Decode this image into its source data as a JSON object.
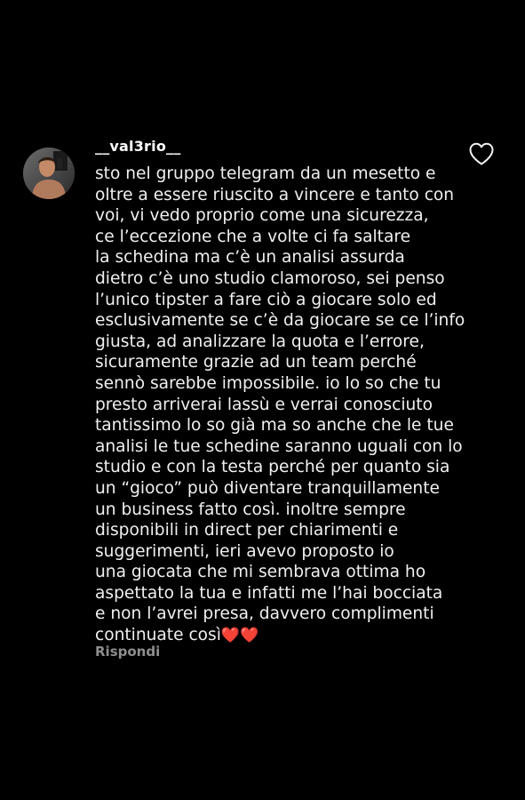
{
  "comment": {
    "username": "__val3rio__",
    "text": "sto nel gruppo telegram da un mesetto e\noltre a essere riuscito a vincere e tanto con\nvoi, vi vedo proprio come una sicurezza,\nce l’eccezione che a volte ci fa saltare\nla schedina ma c’è un analisi assurda\ndietro c’è uno studio clamoroso, sei penso\nl’unico tipster a fare ciò a giocare solo ed\nesclusivamente se c’è da giocare se ce l’info\ngiusta, ad analizzare la quota e l’errore,\nsicuramente grazie ad un team perché\nsennò sarebbe impossibile. io lo so che tu\npresto arriverai lassù e verrai conosciuto\ntantissimo lo so già ma so anche che le tue\nanalisi le tue schedine saranno uguali con lo\nstudio e con la testa perché per quanto sia\nun “gioco” può diventare tranquillamente\nun business fatto così. inoltre sempre\ndisponibili in direct per chiarimenti e\nsuggerimenti, ieri avevo proposto io\nuna giocata che mi sembrava ottima ho\naspettato la tua e infatti me l’hai bocciata\ne non l’avrei presa, davvero complimenti\ncontinuate così",
    "emoji": "❤️❤️",
    "reply_label": "Rispondi",
    "like_icon": "heart-outline-icon"
  },
  "colors": {
    "background": "#000000",
    "text": "#f0f0f0",
    "muted": "#8e8e8e",
    "heart": "#e0242d"
  }
}
